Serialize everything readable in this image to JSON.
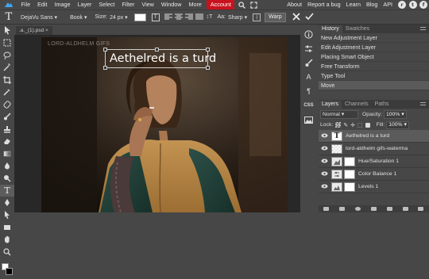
{
  "menubar": {
    "items": [
      "File",
      "Edit",
      "Image",
      "Layer",
      "Select",
      "Filter",
      "View",
      "Window",
      "More"
    ],
    "account": "Account",
    "right_links": [
      "About",
      "Report a bug",
      "Learn",
      "Blog",
      "API"
    ],
    "social": [
      "r",
      "t",
      "f"
    ]
  },
  "options": {
    "font_family": "DejaVu Sans",
    "font_style": "Book",
    "size_label": "Size:",
    "size_value": "24 px",
    "aa_label": "Aa:",
    "aa_value": "Sharp",
    "warp_label": "Warp",
    "text_color": "#ffffff"
  },
  "document": {
    "tab_label": ".a._(1).psd",
    "watermark": "LORD-ALDHELM GIFS",
    "text_layer": "Aethelred is a turd"
  },
  "history": {
    "tabs": [
      "History",
      "Swatches"
    ],
    "items": [
      "New Adjustment Layer",
      "Edit Adjustment Layer",
      "Placing Smart Object",
      "Free Transform",
      "Type Tool",
      "Move"
    ]
  },
  "layers": {
    "tabs": [
      "Layers",
      "Channels",
      "Paths"
    ],
    "blend_mode": "Normal",
    "opacity_label": "Opacity:",
    "opacity_value": "100%",
    "lock_label": "Lock:",
    "fill_label": "Fill:",
    "fill_value": "100%",
    "items": [
      {
        "name": "Aethelred is a turd",
        "type": "text"
      },
      {
        "name": "lord-aldhelm gifs-waterma",
        "type": "smart"
      },
      {
        "name": "Hue/Saturation 1",
        "type": "adjust"
      },
      {
        "name": "Color Balance 1",
        "type": "adjust"
      },
      {
        "name": "Levels 1",
        "type": "adjust"
      }
    ]
  },
  "right_strip": {
    "css_label": "CSS"
  },
  "colors": {
    "accent": "#c8131f",
    "bg": "#474747"
  }
}
